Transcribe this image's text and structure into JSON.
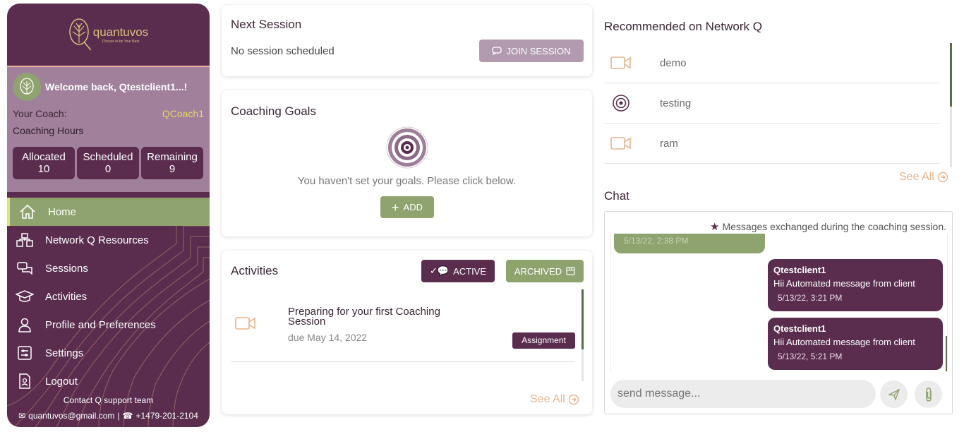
{
  "brand": {
    "name": "quantuvos",
    "tagline": "Choose to be Your Best"
  },
  "profile": {
    "welcome": "Welcome back, Qtestclient1...!",
    "coach_label": "Your Coach:",
    "coach_name": "QCoach1",
    "hours_label": "Coaching Hours",
    "stats": [
      {
        "label": "Allocated",
        "value": "10"
      },
      {
        "label": "Scheduled",
        "value": "0"
      },
      {
        "label": "Remaining",
        "value": "9"
      }
    ]
  },
  "nav": {
    "items": [
      {
        "label": "Home",
        "icon": "home-icon"
      },
      {
        "label": "Network Q Resources",
        "icon": "network-icon"
      },
      {
        "label": "Sessions",
        "icon": "chat-icon"
      },
      {
        "label": "Activities",
        "icon": "graduation-cap-icon"
      },
      {
        "label": "Profile and Preferences",
        "icon": "user-icon"
      },
      {
        "label": "Settings",
        "icon": "settings-icon"
      },
      {
        "label": "Logout",
        "icon": "logout-icon"
      }
    ]
  },
  "contact": {
    "title": "Contact Q support team",
    "email": "quantuvos@gmail.com",
    "phone": "+1479-201-2104"
  },
  "next_session": {
    "title": "Next Session",
    "status": "No session scheduled",
    "join_label": "JOIN SESSION"
  },
  "goals": {
    "title": "Coaching Goals",
    "message": "You haven't set your goals. Please click below.",
    "add_label": "ADD"
  },
  "activities": {
    "title": "Activities",
    "active_label": "ACTIVE",
    "archived_label": "ARCHIVED",
    "item": {
      "title": "Preparing for your first Coaching Session",
      "due": "due May 14, 2022",
      "tag": "Assignment"
    },
    "see_all": "See All"
  },
  "recommended": {
    "title": "Recommended on Network Q",
    "items": [
      {
        "label": "demo",
        "icon": "video-icon"
      },
      {
        "label": "testing",
        "icon": "target-icon"
      },
      {
        "label": "ram",
        "icon": "video-icon"
      }
    ],
    "see_all": "See All"
  },
  "chat": {
    "title": "Chat",
    "notice": "Messages exchanged during the coaching session.",
    "partial_ts": "5/13/22, 2:38 PM",
    "messages": [
      {
        "sender": "Qtestclient1",
        "text": "Hii Automated message from client",
        "time": "5/13/22, 3:21 PM"
      },
      {
        "sender": "Qtestclient1",
        "text": "Hii Automated message from client",
        "time": "5/13/22, 5:21 PM"
      }
    ],
    "placeholder": "send message..."
  },
  "colors": {
    "primary": "#5a2d4f",
    "green": "#8fa36f",
    "mauve": "#a0809a",
    "peach": "#e8b48c",
    "yellow": "#e5d86a"
  }
}
